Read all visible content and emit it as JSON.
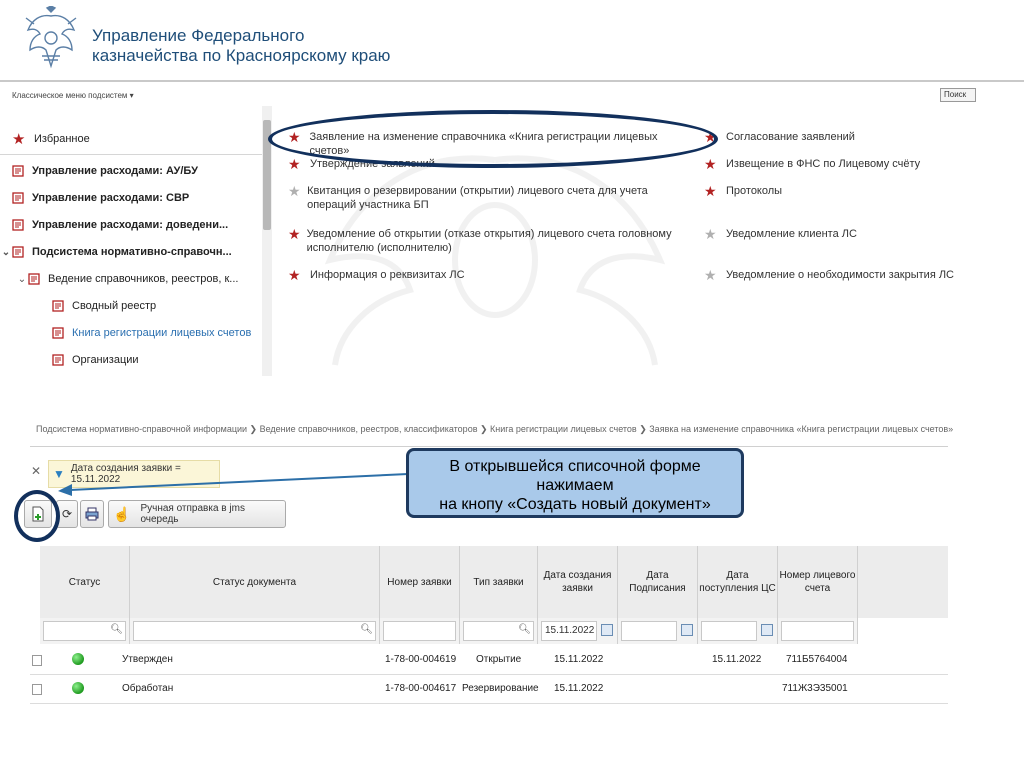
{
  "header": {
    "line1": "Управление Федерального",
    "line2": "казначейства по Красноярскому краю"
  },
  "menu": {
    "label": "Классическое меню подсистем",
    "search_label": "Поиск"
  },
  "sidebar": {
    "items": [
      {
        "label": "Избранное"
      },
      {
        "label": "Управление расходами: АУ/БУ"
      },
      {
        "label": "Управление расходами: СВР"
      },
      {
        "label": "Управление расходами: доведени..."
      },
      {
        "label": "Подсистема нормативно-справочн..."
      },
      {
        "label": "Ведение справочников, реестров, к..."
      },
      {
        "label": "Сводный реестр"
      },
      {
        "label": "Книга регистрации лицевых счетов"
      },
      {
        "label": "Организации"
      }
    ]
  },
  "favorites": {
    "col1": [
      {
        "text": "Заявление на изменение справочника «Книга регистрации лицевых счетов»"
      },
      {
        "text": "Утверждение заявлений"
      },
      {
        "text": "Квитанция о резервировании (открытии) лицевого счета для учета операций участника БП"
      },
      {
        "text": "Уведомление об открытии (отказе открытия) лицевого счета головному исполнителю (исполнителю)"
      },
      {
        "text": "Информация о реквизитах ЛС"
      }
    ],
    "col2": [
      {
        "text": "Согласование заявлений"
      },
      {
        "text": "Извещение в ФНС по Лицевому счёту"
      },
      {
        "text": "Протоколы"
      },
      {
        "text": "Уведомление клиента ЛС"
      },
      {
        "text": "Уведомление о необходимости закрытия ЛС"
      }
    ]
  },
  "breadcrumb": "Подсистема нормативно-справочной информации  ❯ Ведение справочников, реестров, классификаторов  ❯ Книга регистрации лицевых счетов  ❯ Заявка на изменение справочника «Книга регистрации лицевых счетов»",
  "filter": {
    "text": "Дата создания заявки = 15.11.2022"
  },
  "toolbar": {
    "manual_send_label": "Ручная отправка в jms очередь"
  },
  "callout": {
    "line1": "В открывшейся списочной форме",
    "line2": "нажимаем",
    "line3": "на кнопу «Создать новый документ»"
  },
  "grid": {
    "headers": {
      "status": "Статус",
      "doc_status": "Статус документа",
      "number": "Номер заявки",
      "type": "Тип заявки",
      "created": "Дата создания заявки",
      "signed": "Дата Подписания",
      "received": "Дата поступления ЦС",
      "account": "Номер лицевого счета"
    },
    "filter_date": "15.11.2022",
    "rows": [
      {
        "doc_status": "Утвержден",
        "number": "1-78-00-004619",
        "type": "Открытие",
        "created": "15.11.2022",
        "signed": "",
        "received": "15.11.2022",
        "account": "711Б5764004"
      },
      {
        "doc_status": "Обработан",
        "number": "1-78-00-004617",
        "type": "Резервирование",
        "created": "15.11.2022",
        "signed": "",
        "received": "",
        "account": "711Ж3Э35001"
      }
    ]
  },
  "colors": {
    "accent": "#1f4e79",
    "star_active": "#b22222",
    "star_inactive": "#b0b0b0",
    "highlight": "#12305c",
    "callout_bg": "#a9c9ea"
  }
}
